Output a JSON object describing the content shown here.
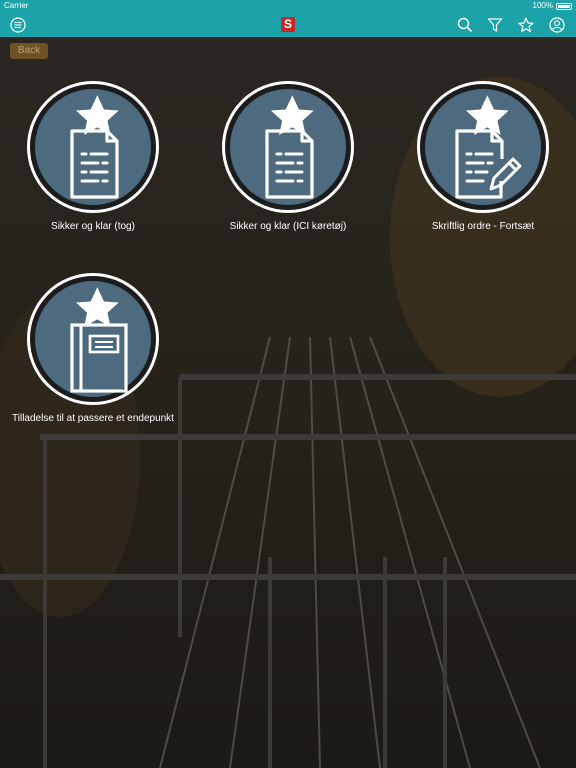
{
  "status": {
    "carrier": "Carrier",
    "time": "",
    "battery": "100%"
  },
  "nav": {
    "logo": "S"
  },
  "back": {
    "label": "Back"
  },
  "tiles": [
    {
      "label": "Sikker og klar (tog)",
      "icon": "document-icon"
    },
    {
      "label": "Sikker og klar (ICI køretøj)",
      "icon": "document-icon"
    },
    {
      "label": "Skriftlig ordre - Fortsæt",
      "icon": "document-edit-icon"
    },
    {
      "label": "Tilladelse til at passere et endepunkt",
      "icon": "booklet-icon"
    }
  ],
  "colors": {
    "accent": "#1ba3a9",
    "tile": "#4e6a7e",
    "logo": "#c62828"
  }
}
